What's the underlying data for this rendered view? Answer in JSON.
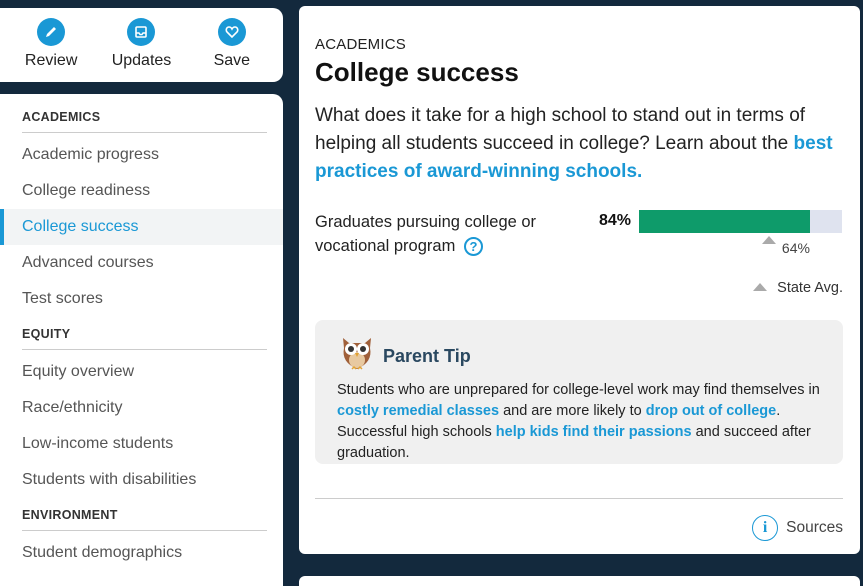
{
  "actions": [
    {
      "label": "Review",
      "icon": "pencil-icon"
    },
    {
      "label": "Updates",
      "icon": "inbox-icon"
    },
    {
      "label": "Save",
      "icon": "heart-icon"
    }
  ],
  "sidebar": {
    "sections": [
      {
        "heading": "ACADEMICS",
        "items": [
          "Academic progress",
          "College readiness",
          "College success",
          "Advanced courses",
          "Test scores"
        ]
      },
      {
        "heading": "EQUITY",
        "items": [
          "Equity overview",
          "Race/ethnicity",
          "Low-income students",
          "Students with disabilities"
        ]
      },
      {
        "heading": "ENVIRONMENT",
        "items": [
          "Student demographics"
        ]
      }
    ],
    "active_item": "College success"
  },
  "main": {
    "eyebrow": "ACADEMICS",
    "title": "College success",
    "lead_text": "What does it take for a high school to stand out in terms of helping all students succeed in college? Learn about the",
    "lead_link": "best practices of award-winning schools.",
    "metric": {
      "label": "Graduates pursuing college or vocational program",
      "value": "84%",
      "value_fraction": 0.84,
      "state_avg": "64%",
      "state_avg_fraction": 0.64,
      "help_symbol": "?"
    },
    "legend_label": "State Avg.",
    "tip": {
      "title": "Parent Tip",
      "text_1": "Students who are unprepared for college-level work may find themselves in",
      "link_1": "costly remedial classes",
      "text_2": "and are more likely to",
      "link_2": "drop out of college",
      "text_3": ". Successful high schools",
      "link_3": "help kids find their passions",
      "text_4": "and succeed after graduation."
    },
    "sources_label": "Sources"
  },
  "colors": {
    "accent": "#1a98d5",
    "bar_fill": "#0e9b6a",
    "bar_track": "#dfe3ef",
    "background": "#13293d"
  }
}
